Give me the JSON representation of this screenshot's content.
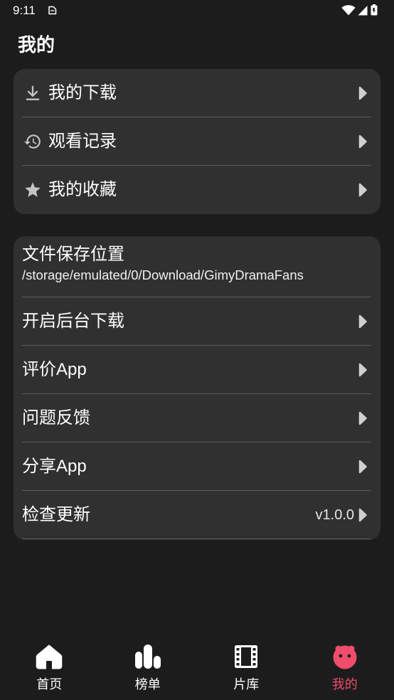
{
  "status_bar": {
    "time": "9:11",
    "left_icons": [
      "notification-icon"
    ],
    "right_icons": [
      "wifi-icon",
      "signal-icon",
      "battery-icon"
    ]
  },
  "header": {
    "title": "我的"
  },
  "quick_links": {
    "items": [
      {
        "icon": "download-icon",
        "label": "我的下载"
      },
      {
        "icon": "history-icon",
        "label": "观看记录"
      },
      {
        "icon": "star-icon",
        "label": "我的收藏"
      }
    ],
    "trailing_icon": "chevron-right-icon"
  },
  "settings": {
    "save_location": {
      "label": "文件保存位置",
      "path": "/storage/emulated/0/Download/GimyDramaFans"
    },
    "items": [
      {
        "label": "开启后台下载"
      },
      {
        "label": "评价App"
      },
      {
        "label": "问题反馈"
      },
      {
        "label": "分享App"
      },
      {
        "label": "检查更新",
        "value": "v1.0.0"
      }
    ],
    "trailing_icon": "chevron-right-icon"
  },
  "bottom_nav": {
    "active_index": 3,
    "items": [
      {
        "icon": "home-icon",
        "label": "首页"
      },
      {
        "icon": "bar-chart-icon",
        "label": "榜单"
      },
      {
        "icon": "film-icon",
        "label": "片库"
      },
      {
        "icon": "mascot-icon",
        "label": "我的"
      }
    ]
  },
  "colors": {
    "background": "#1c1c1c",
    "card": "#303030",
    "divider": "#5c5c5c",
    "text": "#ffffff",
    "icon": "#c4c4c4",
    "chevron": "#cfcfcf",
    "accent": "#ef4d6b"
  }
}
